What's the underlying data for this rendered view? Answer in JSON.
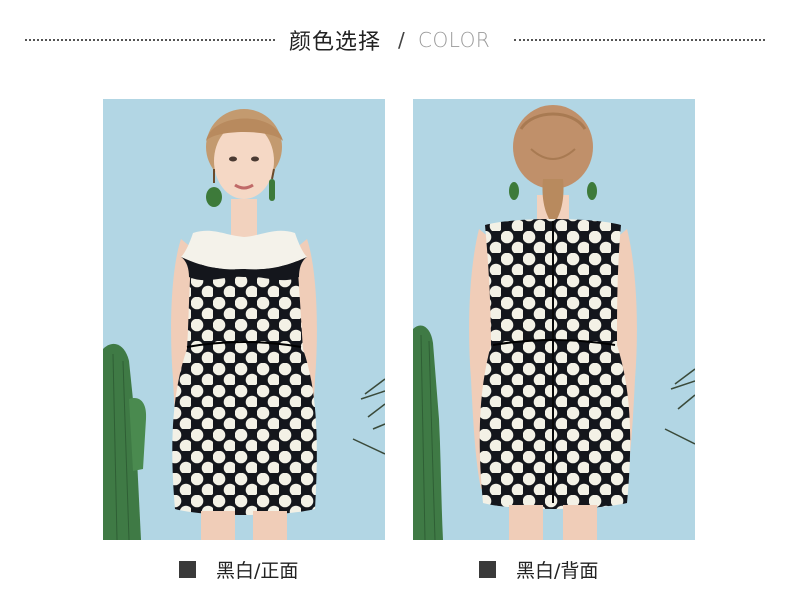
{
  "header": {
    "title_cn": "颜色选择",
    "slash": "/",
    "title_en": "COLOR"
  },
  "colors": {
    "swatch": "#3a3a3a",
    "dress_black": "#14161c",
    "dress_dot": "#f3f1e6",
    "background_blue": "#b2d6e4"
  },
  "options": [
    {
      "label": "黑白/正面",
      "view": "front"
    },
    {
      "label": "黑白/背面",
      "view": "back"
    }
  ]
}
